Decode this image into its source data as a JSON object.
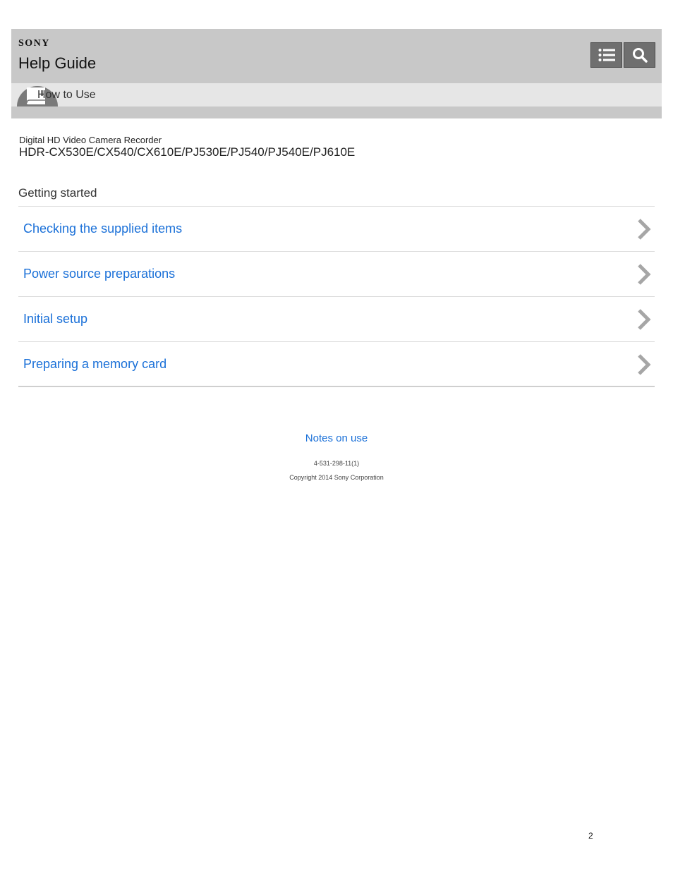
{
  "header": {
    "brand": "SONY",
    "title": "Help Guide",
    "toolbar": {
      "list_icon": "list-icon",
      "search_icon": "search-icon"
    },
    "subbar": {
      "label": "How to Use",
      "icon": "book-icon"
    }
  },
  "document": {
    "subtitle": "Digital HD Video Camera Recorder",
    "model": "HDR-CX530E/CX540/CX610E/PJ530E/PJ540/PJ540E/PJ610E"
  },
  "section": {
    "title": "Getting started",
    "items": [
      {
        "label": "Checking the supplied items"
      },
      {
        "label": "Power source preparations"
      },
      {
        "label": "Initial setup"
      },
      {
        "label": "Preparing a memory card"
      }
    ]
  },
  "footer": {
    "notes_link": "Notes on use",
    "doc_code": "4-531-298-11(1)",
    "copyright": "Copyright 2014 Sony Corporation"
  },
  "page_number": "2",
  "colors": {
    "header_bg": "#c8c8c8",
    "subbar_bg": "#e6e6e6",
    "link": "#1a70d8",
    "button_bg": "#6f6f6f"
  }
}
